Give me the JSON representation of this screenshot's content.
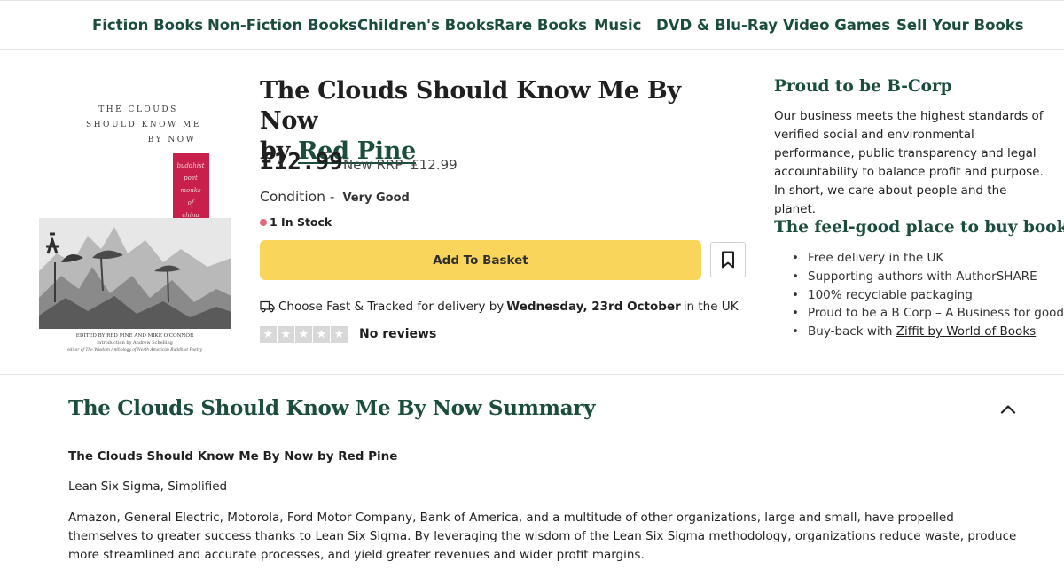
{
  "nav": {
    "items": [
      "Fiction Books",
      "Non-Fiction Books",
      "Children's Books",
      "Rare Books",
      "Music",
      "DVD & Blu-Ray",
      "Video Games",
      "Sell Your Books"
    ]
  },
  "cover": {
    "title_lines": [
      "THE CLOUDS",
      "SHOULD KNOW ME",
      "BY NOW"
    ],
    "tag_lines": [
      "buddhist",
      "poet",
      "monks",
      "of",
      "china"
    ],
    "credit_lines": [
      "EDITED BY RED PINE AND MIKE O'CONNOR",
      "Introduction by Andrew Schelling",
      "editor of The Wisdom Anthology of North American Buddhist Poetry"
    ],
    "accent_color": "#c81f4c"
  },
  "product": {
    "title": "The Clouds Should Know Me By Now",
    "by": "by",
    "author": "Red Pine",
    "price": "£12.99",
    "rrp_label": "New RRP",
    "rrp_value": "£12.99",
    "condition_label": "Condition -",
    "condition_value": "Very Good",
    "stock": "1 In Stock",
    "basket_label": "Add To Basket",
    "delivery_prefix": "Choose Fast & Tracked for delivery by",
    "delivery_date": "Wednesday, 23rd October",
    "delivery_suffix": "in the UK",
    "reviews": "No reviews",
    "rating": 0,
    "rating_max": 5
  },
  "sidebar": {
    "bcorp_title": "Proud to be B-Corp",
    "bcorp_text": "Our business meets the highest standards of verified social and environmental performance, public transparency and legal accountability to balance profit and purpose. In short, we care about people and the planet.",
    "feel_title": "The feel-good place to buy books",
    "feel_items": [
      "Free delivery in the UK",
      "Supporting authors with AuthorSHARE",
      "100% recyclable packaging",
      "Proud to be a B Corp – A Business for good"
    ],
    "buyback_prefix": "Buy-back with",
    "buyback_link": "Ziffit by World of Books"
  },
  "summary": {
    "title": "The Clouds Should Know Me By Now Summary",
    "heading": "The Clouds Should Know Me By Now by Red Pine",
    "subheading": "Lean Six Sigma, Simplified",
    "paragraph": "Amazon, General Electric, Motorola, Ford Motor Company, Bank of America, and a multitude of other organizations, large and small, have propelled themselves to greater success thanks to Lean Six Sigma. By leveraging the wisdom of the Lean Six Sigma methodology, organizations reduce waste, produce more streamlined and accurate processes, and yield greater revenues and wider profit margins."
  },
  "colors": {
    "brand_green": "#1b4d3e",
    "basket_yellow": "#fad55b",
    "stock_dot": "#e06a7a"
  }
}
